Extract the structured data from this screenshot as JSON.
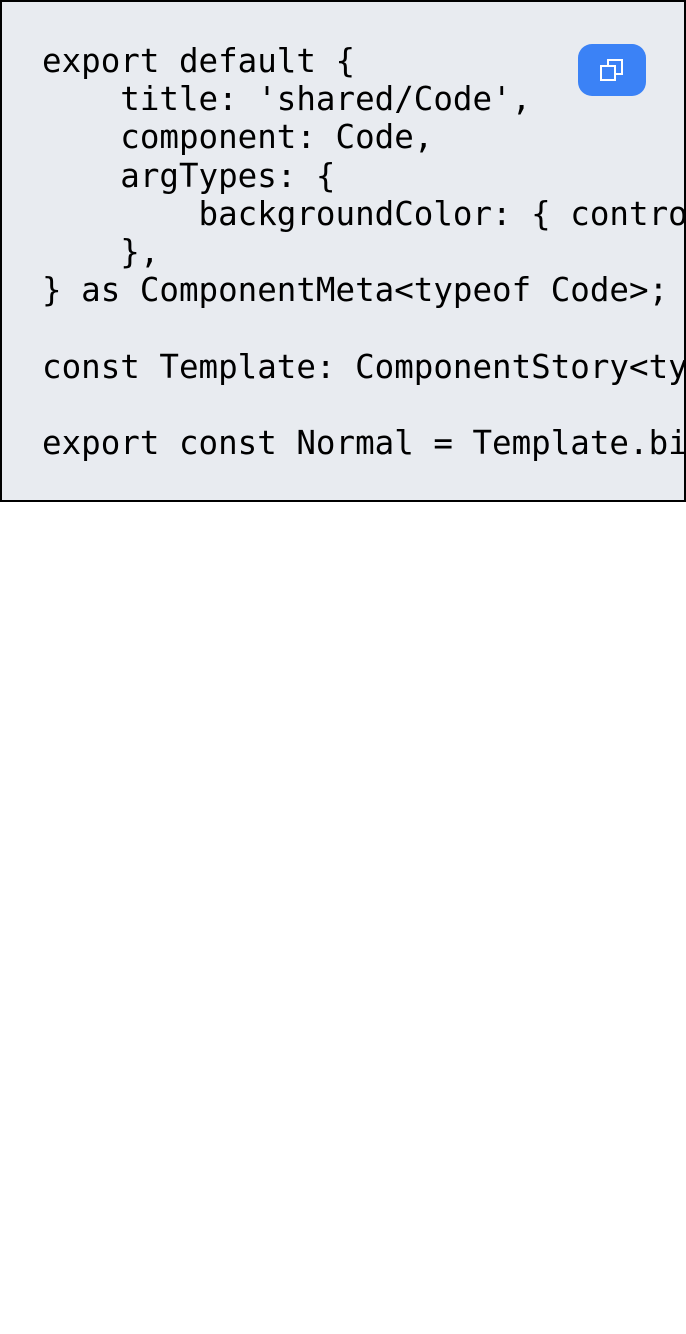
{
  "code_block": {
    "background_color": "#e8ebf0",
    "border_color": "#000000",
    "lines": [
      "export default {",
      "    title: 'shared/Code',",
      "    component: Code,",
      "    argTypes: {",
      "        backgroundColor: { control",
      "    },",
      "} as ComponentMeta<typeof Code>;",
      "",
      "const Template: ComponentStory<typ",
      "",
      "export const Normal = Template.bin"
    ]
  },
  "copy_button": {
    "icon": "copy-icon",
    "color": "#3b82f6"
  }
}
